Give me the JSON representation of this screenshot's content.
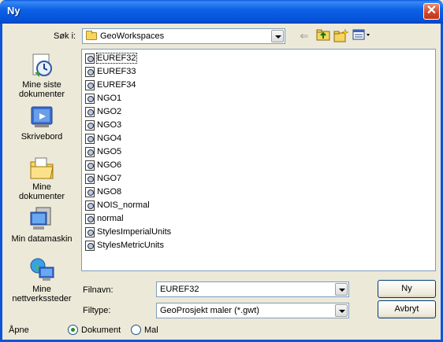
{
  "window": {
    "title": "Ny",
    "close_glyph": "✕"
  },
  "lookin": {
    "label": "Søk i:",
    "value": "GeoWorkspaces"
  },
  "toolbar": {
    "back_glyph": "⇐",
    "up_glyph": "⮤",
    "newfolder_glyph": "✱",
    "views_glyph": "▦▾"
  },
  "places": [
    {
      "label_line1": "Mine siste",
      "label_line2": "dokumenter",
      "icon": "recent-documents-icon"
    },
    {
      "label_line1": "Skrivebord",
      "label_line2": "",
      "icon": "desktop-icon"
    },
    {
      "label_line1": "Mine",
      "label_line2": "dokumenter",
      "icon": "my-documents-icon"
    },
    {
      "label_line1": "Min datamaskin",
      "label_line2": "",
      "icon": "my-computer-icon"
    },
    {
      "label_line1": "Mine",
      "label_line2": "nettverkssteder",
      "icon": "network-places-icon"
    }
  ],
  "files": [
    "EUREF32",
    "EUREF33",
    "EUREF34",
    "NGO1",
    "NGO2",
    "NGO3",
    "NGO4",
    "NGO5",
    "NGO6",
    "NGO7",
    "NGO8",
    "NOIS_normal",
    "normal",
    "StylesImperialUnits",
    "StylesMetricUnits"
  ],
  "filename": {
    "label": "Filnavn:",
    "value": "EUREF32"
  },
  "filetype": {
    "label": "Filtype:",
    "value": "GeoProsjekt maler (*.gwt)"
  },
  "buttons": {
    "ok": "Ny",
    "cancel": "Avbryt"
  },
  "open_as": {
    "label": "Åpne",
    "option1": "Dokument",
    "option2": "Mal"
  }
}
